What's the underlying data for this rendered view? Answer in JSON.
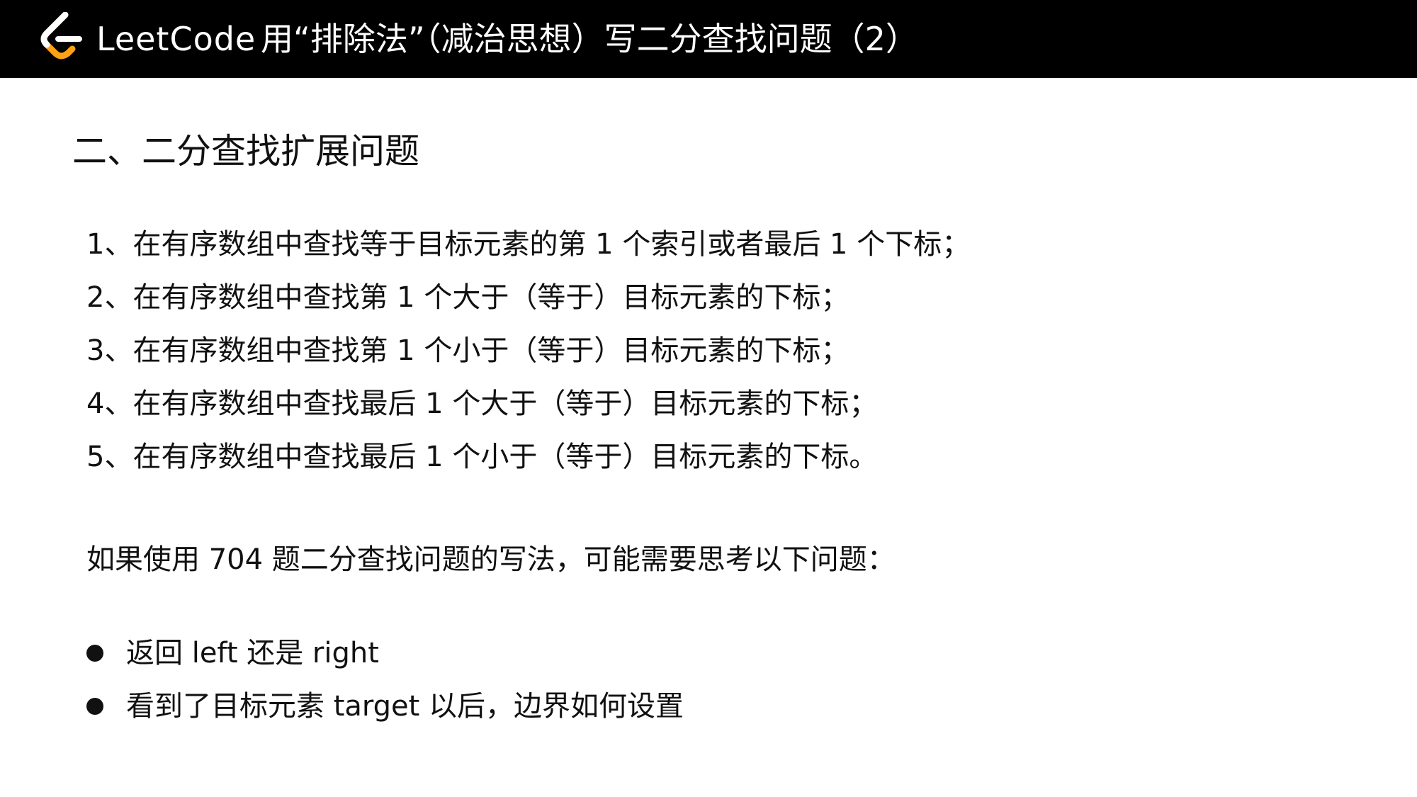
{
  "header": {
    "brand": "LeetCode",
    "title": "用“排除法”（减治思想）写二分查找问题（2）"
  },
  "section": {
    "title": "二、二分查找扩展问题"
  },
  "list_items": [
    "1、在有序数组中查找等于目标元素的第 1 个索引或者最后 1 个下标；",
    "2、在有序数组中查找第 1 个大于（等于）目标元素的下标；",
    "3、在有序数组中查找第 1 个小于（等于）目标元素的下标；",
    "4、在有序数组中查找最后 1 个大于（等于）目标元素的下标；",
    "5、在有序数组中查找最后 1 个小于（等于）目标元素的下标。"
  ],
  "question": "如果使用 704 题二分查找问题的写法，可能需要思考以下问题：",
  "bullets": [
    "返回 left 还是 right",
    "看到了目标元素 target 以后，边界如何设置"
  ],
  "colors": {
    "header_bg": "#000000",
    "logo_orange": "#FFA116",
    "logo_white": "#FFFFFF",
    "text": "#111111"
  },
  "icons": {
    "logo": "leetcode-logo-icon",
    "bullet": "bullet-dot-icon"
  }
}
